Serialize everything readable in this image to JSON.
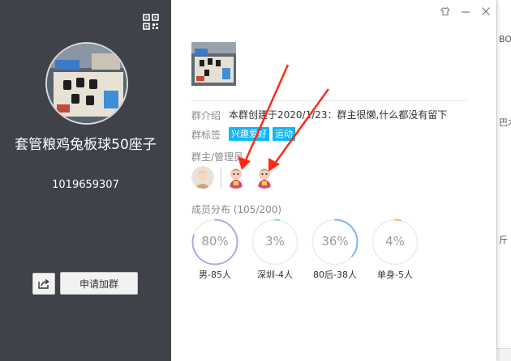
{
  "background": {
    "right_fragments": [
      "BOY",
      "巴木",
      "斤"
    ]
  },
  "left": {
    "group_name": "套管粮鸡兔板球50座子",
    "group_id": "1019659307",
    "join_label": "申请加群",
    "icons": {
      "qr": "qr-code-icon",
      "share": "share-icon"
    }
  },
  "titlebar": {
    "icons": [
      "skin-icon",
      "minimize-icon",
      "close-icon"
    ]
  },
  "info": {
    "intro_label": "群介绍",
    "intro_text": "本群创建于2020/1/23：群主很懒,什么都没有留下",
    "tags_label": "群标签",
    "tags": [
      "兴趣爱好",
      "运动"
    ],
    "admins_label": "群主/管理员"
  },
  "members": {
    "title": "成员分布 (105/200)",
    "stats": [
      {
        "value": "80%",
        "label": "男-85人",
        "fraction": 0.8,
        "color": "#b9a4e8"
      },
      {
        "value": "3%",
        "label": "深圳-4人",
        "fraction": 0.03,
        "color": "#7ed9c3"
      },
      {
        "value": "36%",
        "label": "80后-38人",
        "fraction": 0.36,
        "color": "#7fb5f0"
      },
      {
        "value": "4%",
        "label": "单身-5人",
        "fraction": 0.04,
        "color": "#f5b66a"
      }
    ]
  },
  "colors": {
    "left_panel": "#3f4349",
    "tag": "#12b7f5",
    "annotation": "#ff2a1a"
  }
}
